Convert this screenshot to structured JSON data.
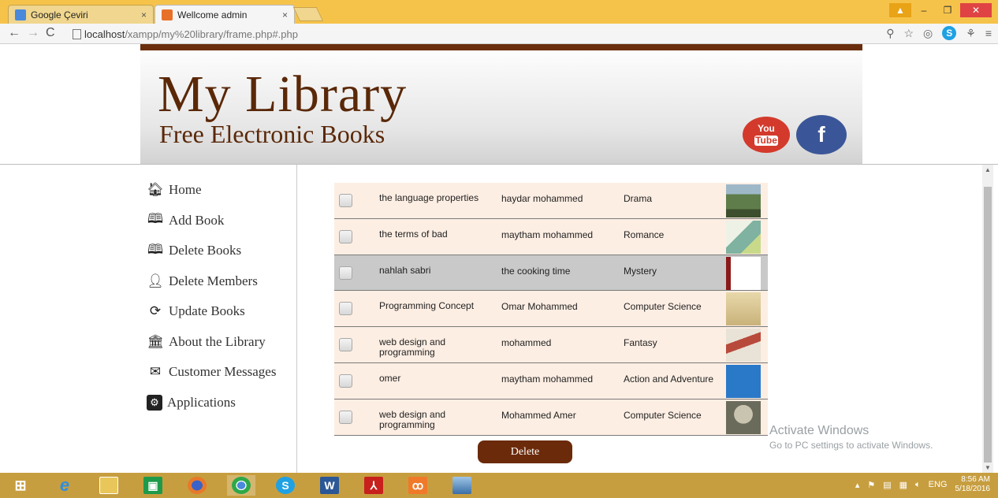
{
  "browser": {
    "tabs": [
      {
        "title": "Google Çeviri"
      },
      {
        "title": "Wellcome admin"
      }
    ],
    "close_glyph": "×",
    "url_host": "localhost",
    "url_path": "/xampp/my%20library/frame.php#.php"
  },
  "header": {
    "title": "My Library",
    "subtitle": "Free Electronic Books",
    "youtube_top": "You",
    "youtube_bottom": "Tube",
    "facebook": "f"
  },
  "sidebar": {
    "items": [
      {
        "label": "Home",
        "icon": "home-icon"
      },
      {
        "label": "Add Book",
        "icon": "open-book-icon"
      },
      {
        "label": "Delete Books",
        "icon": "book-delete-icon"
      },
      {
        "label": "Delete Members",
        "icon": "user-remove-icon"
      },
      {
        "label": "Update Books",
        "icon": "refresh-icon"
      },
      {
        "label": "About the Library",
        "icon": "bank-icon"
      },
      {
        "label": "Customer Messages",
        "icon": "envelope-icon"
      },
      {
        "label": "Applications",
        "icon": "apps-icon"
      }
    ]
  },
  "books": {
    "rows": [
      {
        "name": "the language properties",
        "author": "haydar mohammed",
        "genre": "Drama",
        "cover_color": "#5f7d4a",
        "selected": false
      },
      {
        "name": "the terms of bad",
        "author": "maytham mohammed",
        "genre": "Romance",
        "cover_color": "#7fb2a0",
        "selected": false
      },
      {
        "name": "nahlah sabri",
        "author": "the cooking time",
        "genre": "Mystery",
        "cover_color": "#8b1a1a",
        "selected": true
      },
      {
        "name": "Programming Concept",
        "author": "Omar Mohammed",
        "genre": "Computer Science",
        "cover_color": "#d6c190",
        "selected": false
      },
      {
        "name": "web design and programming",
        "author": "mohammed",
        "genre": "Fantasy",
        "cover_color": "#b84a3c",
        "selected": false
      },
      {
        "name": "omer",
        "author": "maytham mohammed",
        "genre": "Action and Adventure",
        "cover_color": "#2a78c8",
        "selected": false
      },
      {
        "name": "web design and programming",
        "author": "Mohammed Amer",
        "genre": "Computer Science",
        "cover_color": "#6b6b5c",
        "selected": false
      }
    ]
  },
  "actions": {
    "delete_label": "Delete"
  },
  "watermark": {
    "line1": "Activate Windows",
    "line2": "Go to PC settings to activate Windows."
  },
  "tray": {
    "lang": "ENG",
    "time": "8:56 AM",
    "date": "5/18/2016"
  },
  "colors": {
    "brand_brown": "#5a2808",
    "row_bg": "#fdeee3",
    "row_selected": "#c9c9c9",
    "taskbar": "#c79e3f"
  }
}
